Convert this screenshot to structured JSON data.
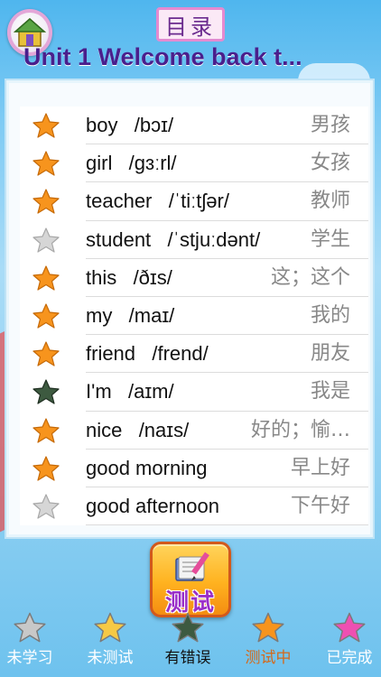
{
  "header": {
    "home_icon": "home-icon",
    "index_label": "目录",
    "unit_title": "Unit 1 Welcome back t..."
  },
  "colors": {
    "star_orange": "#f7941d",
    "star_gray": "#d6d6d6",
    "star_dark": "#3d5a40",
    "title_purple": "#4a1f8c"
  },
  "words": [
    {
      "word": "boy   /bɔɪ/",
      "meaning": "男孩",
      "status": "orange"
    },
    {
      "word": "girl   /ɡɜːrl/",
      "meaning": "女孩",
      "status": "orange"
    },
    {
      "word": "teacher   /ˈtiːtʃər/",
      "meaning": "教师",
      "status": "orange"
    },
    {
      "word": "student   /ˈstjuːdənt/",
      "meaning": "学生",
      "status": "gray"
    },
    {
      "word": "this   /ðɪs/",
      "meaning": "这；这个",
      "status": "orange"
    },
    {
      "word": "my   /maɪ/",
      "meaning": "我的",
      "status": "orange"
    },
    {
      "word": "friend   /frend/",
      "meaning": "朋友",
      "status": "orange"
    },
    {
      "word": "I'm   /aɪm/",
      "meaning": "我是",
      "status": "dark"
    },
    {
      "word": "nice   /naɪs/",
      "meaning": "好的；愉…",
      "status": "orange"
    },
    {
      "word": "good morning",
      "meaning": "早上好",
      "status": "orange"
    },
    {
      "word": "good afternoon",
      "meaning": "下午好",
      "status": "gray"
    }
  ],
  "test_button": {
    "label": "测试",
    "icon": "book-pencil-icon"
  },
  "legend": [
    {
      "label": "未学习",
      "icon": "star-gray-icon",
      "color": "#c8c8c8",
      "text_color": "#ffffff"
    },
    {
      "label": "未测试",
      "icon": "star-yellow-icon",
      "color": "#f6c945",
      "text_color": "#ffffff"
    },
    {
      "label": "有错误",
      "icon": "star-dark-icon",
      "color": "#3d5a40",
      "text_color": "#111111"
    },
    {
      "label": "测试中",
      "icon": "star-orange-icon",
      "color": "#f7941d",
      "text_color": "#d4691a"
    },
    {
      "label": "已完成",
      "icon": "star-pink-icon",
      "color": "#ee4fb2",
      "text_color": "#ffffff"
    }
  ]
}
